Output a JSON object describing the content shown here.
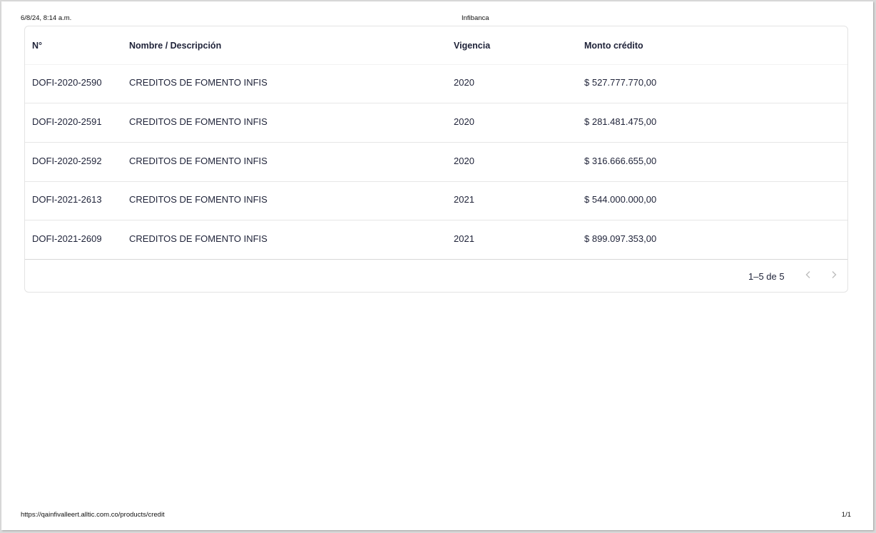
{
  "print_header": {
    "date": "6/8/24, 8:14 a.m.",
    "title": "Infibanca"
  },
  "print_footer": {
    "url": "https://qainfivalleert.alltic.com.co/products/credit",
    "page": "1/1"
  },
  "table": {
    "columns": [
      "N°",
      "Nombre / Descripción",
      "Vigencia",
      "Monto crédito"
    ],
    "rows": [
      {
        "numero": "DOFI-2020-2590",
        "nombre": "CREDITOS DE FOMENTO INFIS",
        "vigencia": "2020",
        "monto": "$ 527.777.770,00"
      },
      {
        "numero": "DOFI-2020-2591",
        "nombre": "CREDITOS DE FOMENTO INFIS",
        "vigencia": "2020",
        "monto": "$ 281.481.475,00"
      },
      {
        "numero": "DOFI-2020-2592",
        "nombre": "CREDITOS DE FOMENTO INFIS",
        "vigencia": "2020",
        "monto": "$ 316.666.655,00"
      },
      {
        "numero": "DOFI-2021-2613",
        "nombre": "CREDITOS DE FOMENTO INFIS",
        "vigencia": "2021",
        "monto": "$ 544.000.000,00"
      },
      {
        "numero": "DOFI-2021-2609",
        "nombre": "CREDITOS DE FOMENTO INFIS",
        "vigencia": "2021",
        "monto": "$ 899.097.353,00"
      }
    ]
  },
  "pagination": {
    "label": "1–5 de 5",
    "prev_icon": "chevron-left-icon",
    "next_icon": "chevron-right-icon",
    "icon_color": "#bdbdbd"
  }
}
